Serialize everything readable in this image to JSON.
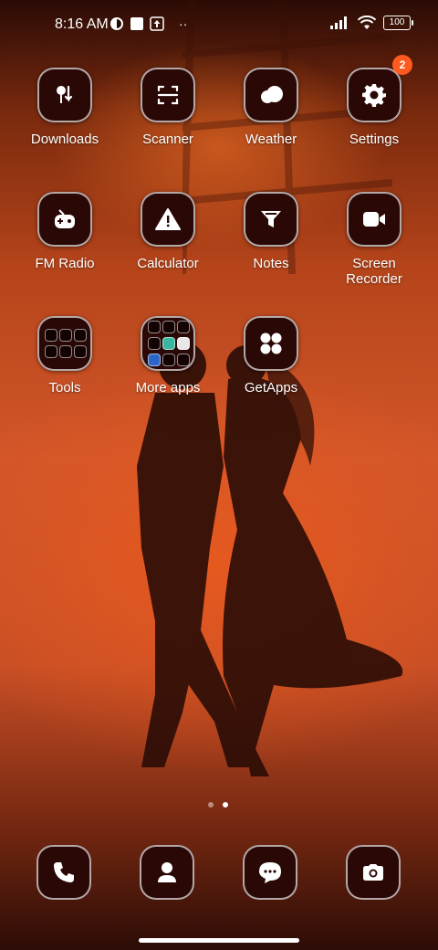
{
  "status_bar": {
    "time": "8:16 AM",
    "battery": "100"
  },
  "apps": {
    "row1": [
      {
        "label": "Downloads"
      },
      {
        "label": "Scanner"
      },
      {
        "label": "Weather"
      },
      {
        "label": "Settings",
        "badge": "2"
      }
    ],
    "row2": [
      {
        "label": "FM Radio"
      },
      {
        "label": "Calculator"
      },
      {
        "label": "Notes"
      },
      {
        "label": "Screen\nRecorder"
      }
    ],
    "row3": [
      {
        "label": "Tools"
      },
      {
        "label": "More apps"
      },
      {
        "label": "GetApps"
      }
    ]
  },
  "page_indicator": {
    "pages": 2,
    "current": 2
  },
  "dock": [
    "phone-icon",
    "contacts-icon",
    "messages-icon",
    "camera-icon"
  ]
}
